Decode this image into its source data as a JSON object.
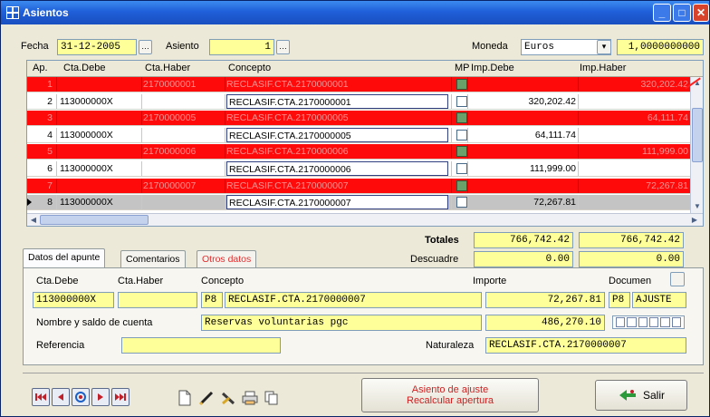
{
  "window": {
    "title": "Asientos"
  },
  "header": {
    "fecha_label": "Fecha",
    "fecha_value": "31-12-2005",
    "asiento_label": "Asiento",
    "asiento_value": "1",
    "moneda_label": "Moneda",
    "moneda_value": "Euros",
    "rate_value": "1,0000000000"
  },
  "grid": {
    "columns": [
      "Ap.",
      "Cta.Debe",
      "Cta.Haber",
      "Concepto",
      "MP",
      "Imp.Debe",
      "Imp.Haber"
    ],
    "rows": [
      {
        "ap": "1",
        "debe": "",
        "haber": "2170000001",
        "concepto": "RECLASIF.CTA.2170000001",
        "mp": true,
        "imp_debe": "",
        "imp_haber": "320,202.42",
        "style": "red"
      },
      {
        "ap": "2",
        "debe": "113000000X",
        "haber": "",
        "concepto": "RECLASIF.CTA.2170000001",
        "mp": false,
        "imp_debe": "320,202.42",
        "imp_haber": "",
        "style": "white"
      },
      {
        "ap": "3",
        "debe": "",
        "haber": "2170000005",
        "concepto": "RECLASIF.CTA.2170000005",
        "mp": true,
        "imp_debe": "",
        "imp_haber": "64,111.74",
        "style": "red"
      },
      {
        "ap": "4",
        "debe": "113000000X",
        "haber": "",
        "concepto": "RECLASIF.CTA.2170000005",
        "mp": false,
        "imp_debe": "64,111.74",
        "imp_haber": "",
        "style": "white"
      },
      {
        "ap": "5",
        "debe": "",
        "haber": "2170000006",
        "concepto": "RECLASIF.CTA.2170000006",
        "mp": true,
        "imp_debe": "",
        "imp_haber": "111,999.00",
        "style": "red"
      },
      {
        "ap": "6",
        "debe": "113000000X",
        "haber": "",
        "concepto": "RECLASIF.CTA.2170000006",
        "mp": false,
        "imp_debe": "111,999.00",
        "imp_haber": "",
        "style": "white"
      },
      {
        "ap": "7",
        "debe": "",
        "haber": "2170000007",
        "concepto": "RECLASIF.CTA.2170000007",
        "mp": true,
        "imp_debe": "",
        "imp_haber": "72,267.81",
        "style": "red"
      },
      {
        "ap": "8",
        "debe": "113000000X",
        "haber": "",
        "concepto": "RECLASIF.CTA.2170000007",
        "mp": false,
        "imp_debe": "72,267.81",
        "imp_haber": "",
        "style": "sel"
      }
    ]
  },
  "totals": {
    "totales_label": "Totales",
    "totales_debe": "766,742.42",
    "totales_haber": "766,742.42",
    "descuadre_label": "Descuadre",
    "descuadre_debe": "0.00",
    "descuadre_haber": "0.00"
  },
  "tabs": [
    "Datos del apunte",
    "Comentarios",
    "Otros datos"
  ],
  "detail": {
    "cta_debe_label": "Cta.Debe",
    "cta_haber_label": "Cta.Haber",
    "concepto_label": "Concepto",
    "importe_label": "Importe",
    "documento_label": "Documen",
    "cta_debe_value": "113000000X",
    "cta_haber_value": "",
    "concepto_code": "P8",
    "concepto_value": "RECLASIF.CTA.2170000007",
    "importe_value": "72,267.81",
    "doc_code": "P8",
    "doc_value": "AJUSTE",
    "nombre_label": "Nombre y saldo de cuenta",
    "nombre_value": "Reservas voluntarias pgc",
    "saldo_value": "486,270.10",
    "referencia_label": "Referencia",
    "referencia_value": "",
    "naturaleza_label": "Naturaleza",
    "naturaleza_value": "RECLASIF.CTA.2170000007"
  },
  "footer": {
    "ajuste_line1": "Asiento de ajuste",
    "ajuste_line2": "Recalcular apertura",
    "salir_label": "Salir"
  },
  "colors": {
    "titlebar": "#1f5fd9",
    "field_yellow": "#ffff99",
    "row_red": "#ff0a0a",
    "row_selected": "#c4c4c4"
  }
}
